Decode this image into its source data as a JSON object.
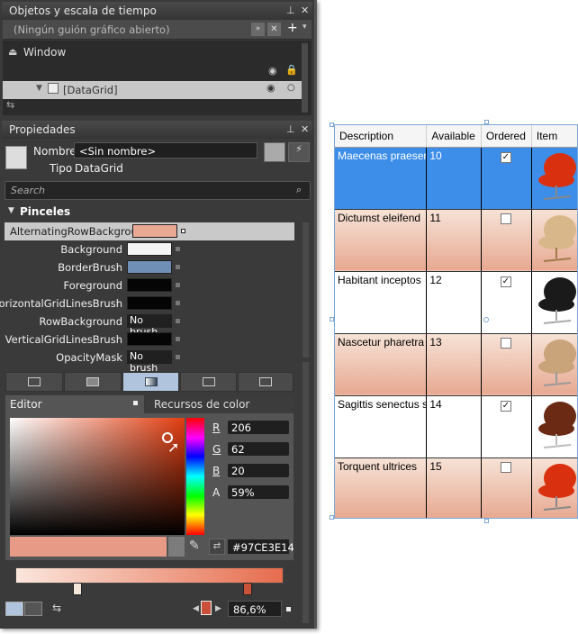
{
  "objects_panel": {
    "title": "Objetos y escala de tiempo",
    "storyboard_placeholder": "(Ningún guión gráfico abierto)",
    "tree": {
      "root": "Window",
      "child": "[DataGrid]"
    }
  },
  "properties_panel": {
    "title": "Propiedades",
    "name_label": "Nombre",
    "name_value": "<Sin nombre>",
    "type_label": "Tipo",
    "type_value": "DataGrid",
    "search_placeholder": "Search",
    "section_brushes": "Pinceles",
    "brush_rows": [
      {
        "label": "AlternatingRowBackground",
        "swatch": "",
        "color": "#e8a893"
      },
      {
        "label": "Background",
        "swatch": "",
        "color": "#f4f4f4"
      },
      {
        "label": "BorderBrush",
        "swatch": "",
        "color": "#6f8fb6"
      },
      {
        "label": "Foreground",
        "swatch": "",
        "color": "#050505"
      },
      {
        "label": "HorizontalGridLinesBrush",
        "swatch": "",
        "color": "#050505"
      },
      {
        "label": "RowBackground",
        "swatch": "No brush",
        "color": ""
      },
      {
        "label": "VerticalGridLinesBrush",
        "swatch": "",
        "color": "#050505"
      },
      {
        "label": "OpacityMask",
        "swatch": "No brush",
        "color": ""
      }
    ],
    "editor_tab": "Editor",
    "resources_tab": "Recursos de color",
    "rgba": {
      "r_label": "R",
      "r": "206",
      "g_label": "G",
      "g": "62",
      "b_label": "B",
      "b": "20",
      "a_label": "A",
      "a": "59%"
    },
    "hex": "#97CE3E14",
    "zoom": "86,6%"
  },
  "datagrid": {
    "columns": [
      "Description",
      "Available",
      "Ordered",
      "Item"
    ],
    "rows": [
      {
        "description": "Maecenas praesent",
        "available": "10",
        "ordered": true,
        "item": "red-chair-icon"
      },
      {
        "description": "Dictumst eleifend",
        "available": "11",
        "ordered": false,
        "item": "wood-chair-icon"
      },
      {
        "description": "Habitant inceptos",
        "available": "12",
        "ordered": true,
        "item": "black-chair-icon"
      },
      {
        "description": "Nascetur pharetra",
        "available": "13",
        "ordered": false,
        "item": "tan-chair-icon"
      },
      {
        "description": "Sagittis senectus s",
        "available": "14",
        "ordered": true,
        "item": "brown-chair-icon"
      },
      {
        "description": "Torquent ultrices",
        "available": "15",
        "ordered": false,
        "item": "red-chair-icon"
      }
    ]
  },
  "colors": {
    "accent_selected": "#3d8ee8",
    "alt_row": "#e8a893",
    "panel_bg": "#3a3a3a"
  }
}
